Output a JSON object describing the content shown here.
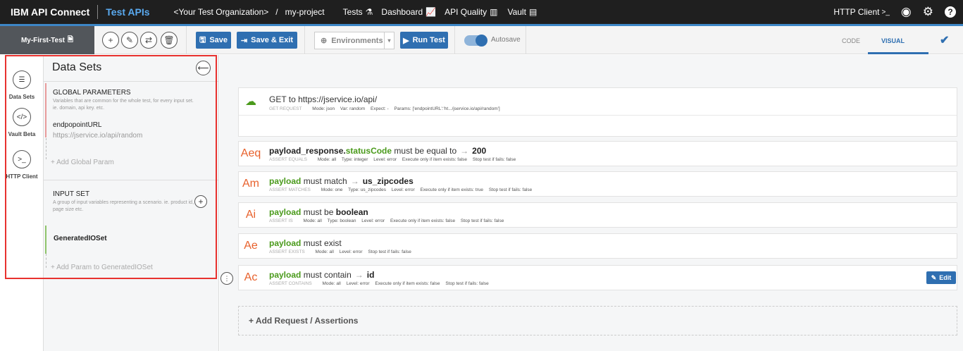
{
  "topbar": {
    "brand": "IBM API Connect",
    "product": "Test APIs",
    "org": "<Your Test Organization>",
    "slash": "/",
    "project": "my-project",
    "nav": [
      {
        "label": "Tests",
        "icon": "flask-icon"
      },
      {
        "label": "Dashboard",
        "icon": "chart-line-icon"
      },
      {
        "label": "API Quality",
        "icon": "bar-chart-icon"
      },
      {
        "label": "Vault",
        "icon": "database-icon"
      }
    ],
    "http_client": "HTTP Client",
    "icons": [
      "user-icon",
      "gear-icon",
      "help-icon"
    ]
  },
  "toolbar": {
    "test_name": "My-First-Test",
    "save": "Save",
    "save_exit": "Save & Exit",
    "environments": "Environments",
    "run_test": "Run Test",
    "autosave": "Autosave",
    "tab_code": "CODE",
    "tab_visual": "VISUAL"
  },
  "rail": [
    {
      "label": "Data Sets",
      "icon": "list-icon"
    },
    {
      "label": "Vault Beta",
      "icon": "code-icon"
    },
    {
      "label": "HTTP Client",
      "icon": "terminal-icon"
    }
  ],
  "panel": {
    "title": "Data Sets",
    "global": {
      "heading": "GLOBAL PARAMETERS",
      "desc": "Variables that are common for the whole test, for every input set. ie. domain, api key. etc.",
      "param_key": "endpopointURL",
      "param_value": "https://jservice.io/api/random",
      "add": "+ Add Global Param"
    },
    "input": {
      "heading": "INPUT SET",
      "desc": "A group of input variables representing a scenario. ie. product id, page size etc.",
      "set_name": "GeneratedIOSet",
      "add": "+ Add Param to GeneratedIOSet"
    }
  },
  "request": {
    "title": "GET to https://jservice.io/api/",
    "kind": "GET REQUEST",
    "mode": "Mode: json",
    "var": "Var: random",
    "expect": "Expect: -",
    "params": "Params: ['endpointURL':'ht.../jservice.io/api/random']"
  },
  "assertions": [
    {
      "abbr": "Aeq",
      "subject": "payload_response.",
      "subject2": "statusCode",
      "verb": "must be equal to",
      "arrow": "→",
      "value": "200",
      "kind": "ASSERT EQUALS",
      "meta": [
        "Mode: all",
        "Type: integer",
        "Level: error",
        "Execute only if item exists: false",
        "Stop test if fails: false"
      ]
    },
    {
      "abbr": "Am",
      "subject": "payload",
      "subject2": "",
      "verb": "must match",
      "arrow": "→",
      "value": "us_zipcodes",
      "kind": "ASSERT MATCHES",
      "meta": [
        "Mode: one",
        "Type: us_zipcodes",
        "Level: error",
        "Execute only if item exists: true",
        "Stop test if fails: false"
      ]
    },
    {
      "abbr": "Ai",
      "subject": "payload",
      "subject2": "",
      "verb": "must be",
      "arrow": "",
      "value": "boolean",
      "kind": "ASSERT IS",
      "meta": [
        "Mode: all",
        "Type: boolean",
        "Level: error",
        "Execute only if item exists: false",
        "Stop test if fails: false"
      ]
    },
    {
      "abbr": "Ae",
      "subject": "payload",
      "subject2": "",
      "verb": "must exist",
      "arrow": "",
      "value": "",
      "kind": "ASSERT EXISTS",
      "meta": [
        "Mode: all",
        "Level: error",
        "Stop test if fails: false"
      ]
    },
    {
      "abbr": "Ac",
      "subject": "payload",
      "subject2": "",
      "verb": "must contain",
      "arrow": "→",
      "value": "id",
      "kind": "ASSERT CONTAINS",
      "meta": [
        "Mode: all",
        "Level: error",
        "Execute only if item exists: false",
        "Stop test if fails: false"
      ]
    }
  ],
  "edit": "Edit",
  "add_request": "+ Add Request / Assertions"
}
